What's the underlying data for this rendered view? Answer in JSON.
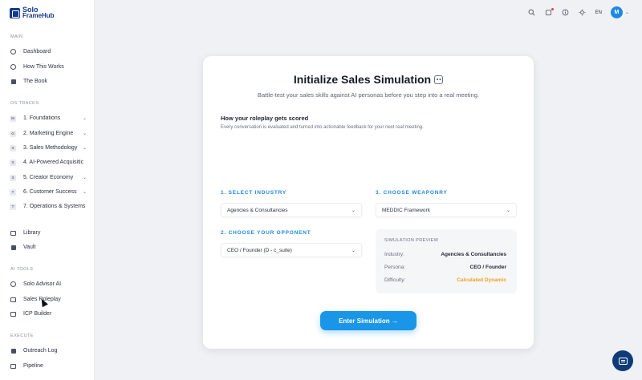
{
  "brand": {
    "line1": "Solo",
    "line2": "FrameHub"
  },
  "sidebar": {
    "main_label": "MAIN",
    "main_items": [
      {
        "label": "Dashboard",
        "icon": "clock-icon"
      },
      {
        "label": "How This Works",
        "icon": "info-icon"
      },
      {
        "label": "The Book",
        "icon": "book-icon"
      }
    ],
    "os_label": "OS TRACKS",
    "os_items": [
      {
        "badge": "M",
        "label": "1. Foundations"
      },
      {
        "badge": "G",
        "label": "2. Marketing Engine"
      },
      {
        "badge": "S",
        "label": "3. Sales Methodology"
      },
      {
        "badge": "S",
        "label": "4. AI-Powered Acquisitic"
      },
      {
        "badge": "S",
        "label": "5. Creator Economy"
      },
      {
        "badge": "T",
        "label": "6. Customer Success"
      },
      {
        "badge": "T",
        "label": "7. Operations & Systems"
      }
    ],
    "misc_items": [
      {
        "label": "Library",
        "icon": "library-icon"
      },
      {
        "label": "Vault",
        "icon": "vault-icon"
      }
    ],
    "ai_label": "AI TOOLS",
    "ai_items": [
      {
        "label": "Solo Advisor AI",
        "icon": "clock-icon"
      },
      {
        "label": "Sales Roleplay",
        "icon": "monitor-icon"
      },
      {
        "label": "ICP Builder",
        "icon": "document-icon"
      }
    ],
    "execute_label": "EXECUTE",
    "execute_items": [
      {
        "label": "Outreach Log",
        "icon": "inbox-icon"
      },
      {
        "label": "Pipeline",
        "icon": "pipeline-icon"
      }
    ]
  },
  "topbar": {
    "language": "EN",
    "avatar_initial": "M"
  },
  "card": {
    "title": "Initialize Sales Simulation",
    "subtitle": "Battle-test your sales skills against AI personas before you step into a real meeting.",
    "score_title": "How your roleplay gets scored",
    "score_subtitle": "Every conversation is evaluated and turned into actionable feedback for your next real meeting.",
    "step1_label": "1. SELECT INDUSTRY",
    "step1_value": "Agencies & Consultancies",
    "step2_label": "2. CHOOSE YOUR OPPONENT",
    "step2_value": "CEO / Founder (D - c_suite)",
    "step3_label": "3. CHOOSE WEAPONRY",
    "step3_value": "MEDDIC Framework",
    "preview": {
      "title": "SIMULATION PREVIEW",
      "industry_key": "Industry:",
      "industry_value": "Agencies & Consultancies",
      "persona_key": "Persona:",
      "persona_value": "CEO / Founder",
      "difficulty_key": "Difficulty:",
      "difficulty_value": "Calculated Dynamic"
    },
    "enter_button": "Enter Simulation →"
  },
  "colors": {
    "accent": "#1e88e5",
    "brand": "#123a8c",
    "warning": "#f0a020",
    "fab": "#0d3c78"
  }
}
